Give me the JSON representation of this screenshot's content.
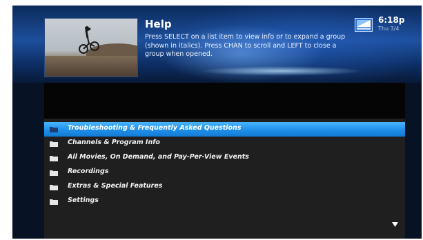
{
  "header": {
    "title": "Help",
    "instructions": "Press SELECT on a list item to view info or to expand a group (shown in italics). Press CHAN to scroll and LEFT to close a group when opened."
  },
  "clock": {
    "time": "6:18p",
    "date": "Thu 3/4"
  },
  "menu": {
    "items": [
      {
        "label": "Troubleshooting & Frequently Asked Questions",
        "selected": true,
        "icon": "folder-icon"
      },
      {
        "label": "Channels & Program Info",
        "selected": false,
        "icon": "folder-icon"
      },
      {
        "label": "All Movies, On Demand, and Pay-Per-View Events",
        "selected": false,
        "icon": "folder-icon"
      },
      {
        "label": "Recordings",
        "selected": false,
        "icon": "folder-icon"
      },
      {
        "label": "Extras & Special Features",
        "selected": false,
        "icon": "folder-icon"
      },
      {
        "label": "Settings",
        "selected": false,
        "icon": "folder-icon"
      }
    ]
  },
  "colors": {
    "highlight": "#1f8ee8",
    "list_background": "#1f1f1f",
    "header_blue": "#1d4f9c"
  }
}
